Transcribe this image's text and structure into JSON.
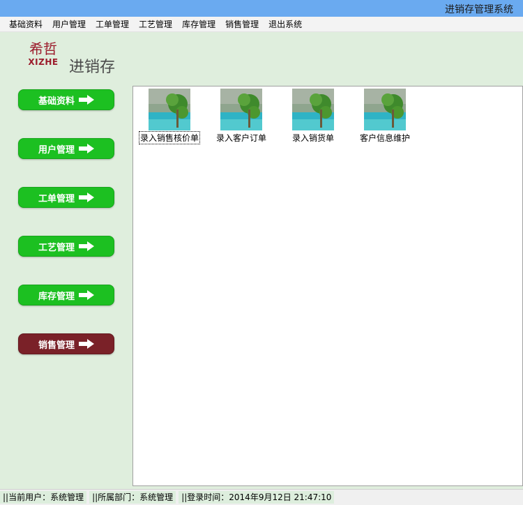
{
  "window": {
    "title": "进销存管理系统"
  },
  "menu": [
    {
      "label": "基础资料"
    },
    {
      "label": "用户管理"
    },
    {
      "label": "工单管理"
    },
    {
      "label": "工艺管理"
    },
    {
      "label": "库存管理"
    },
    {
      "label": "销售管理"
    },
    {
      "label": "退出系统"
    }
  ],
  "logo": {
    "cn": "希哲",
    "en": "XIZHE"
  },
  "app_name": "进销存",
  "nav": [
    {
      "label": "基础资料",
      "active": false
    },
    {
      "label": "用户管理",
      "active": false
    },
    {
      "label": "工单管理",
      "active": false
    },
    {
      "label": "工艺管理",
      "active": false
    },
    {
      "label": "库存管理",
      "active": false
    },
    {
      "label": "销售管理",
      "active": true
    }
  ],
  "tiles": [
    {
      "label": "录入销售核价单",
      "icon": "landscape-thumbnail-icon",
      "focused": true
    },
    {
      "label": "录入客户订单",
      "icon": "landscape-thumbnail-icon",
      "focused": false
    },
    {
      "label": "录入销货单",
      "icon": "landscape-thumbnail-icon",
      "focused": false
    },
    {
      "label": "客户信息维护",
      "icon": "landscape-thumbnail-icon",
      "focused": false
    }
  ],
  "status": {
    "user": "||当前用户：系统管理",
    "dept": "||所属部门：系统管理",
    "login": "||登录时间：2014年9月12日 21:47:10"
  },
  "colors": {
    "nav_green": "#1cc021",
    "nav_active": "#7a2128",
    "title_bar": "#6aaaf0",
    "background": "#dfeedd"
  }
}
